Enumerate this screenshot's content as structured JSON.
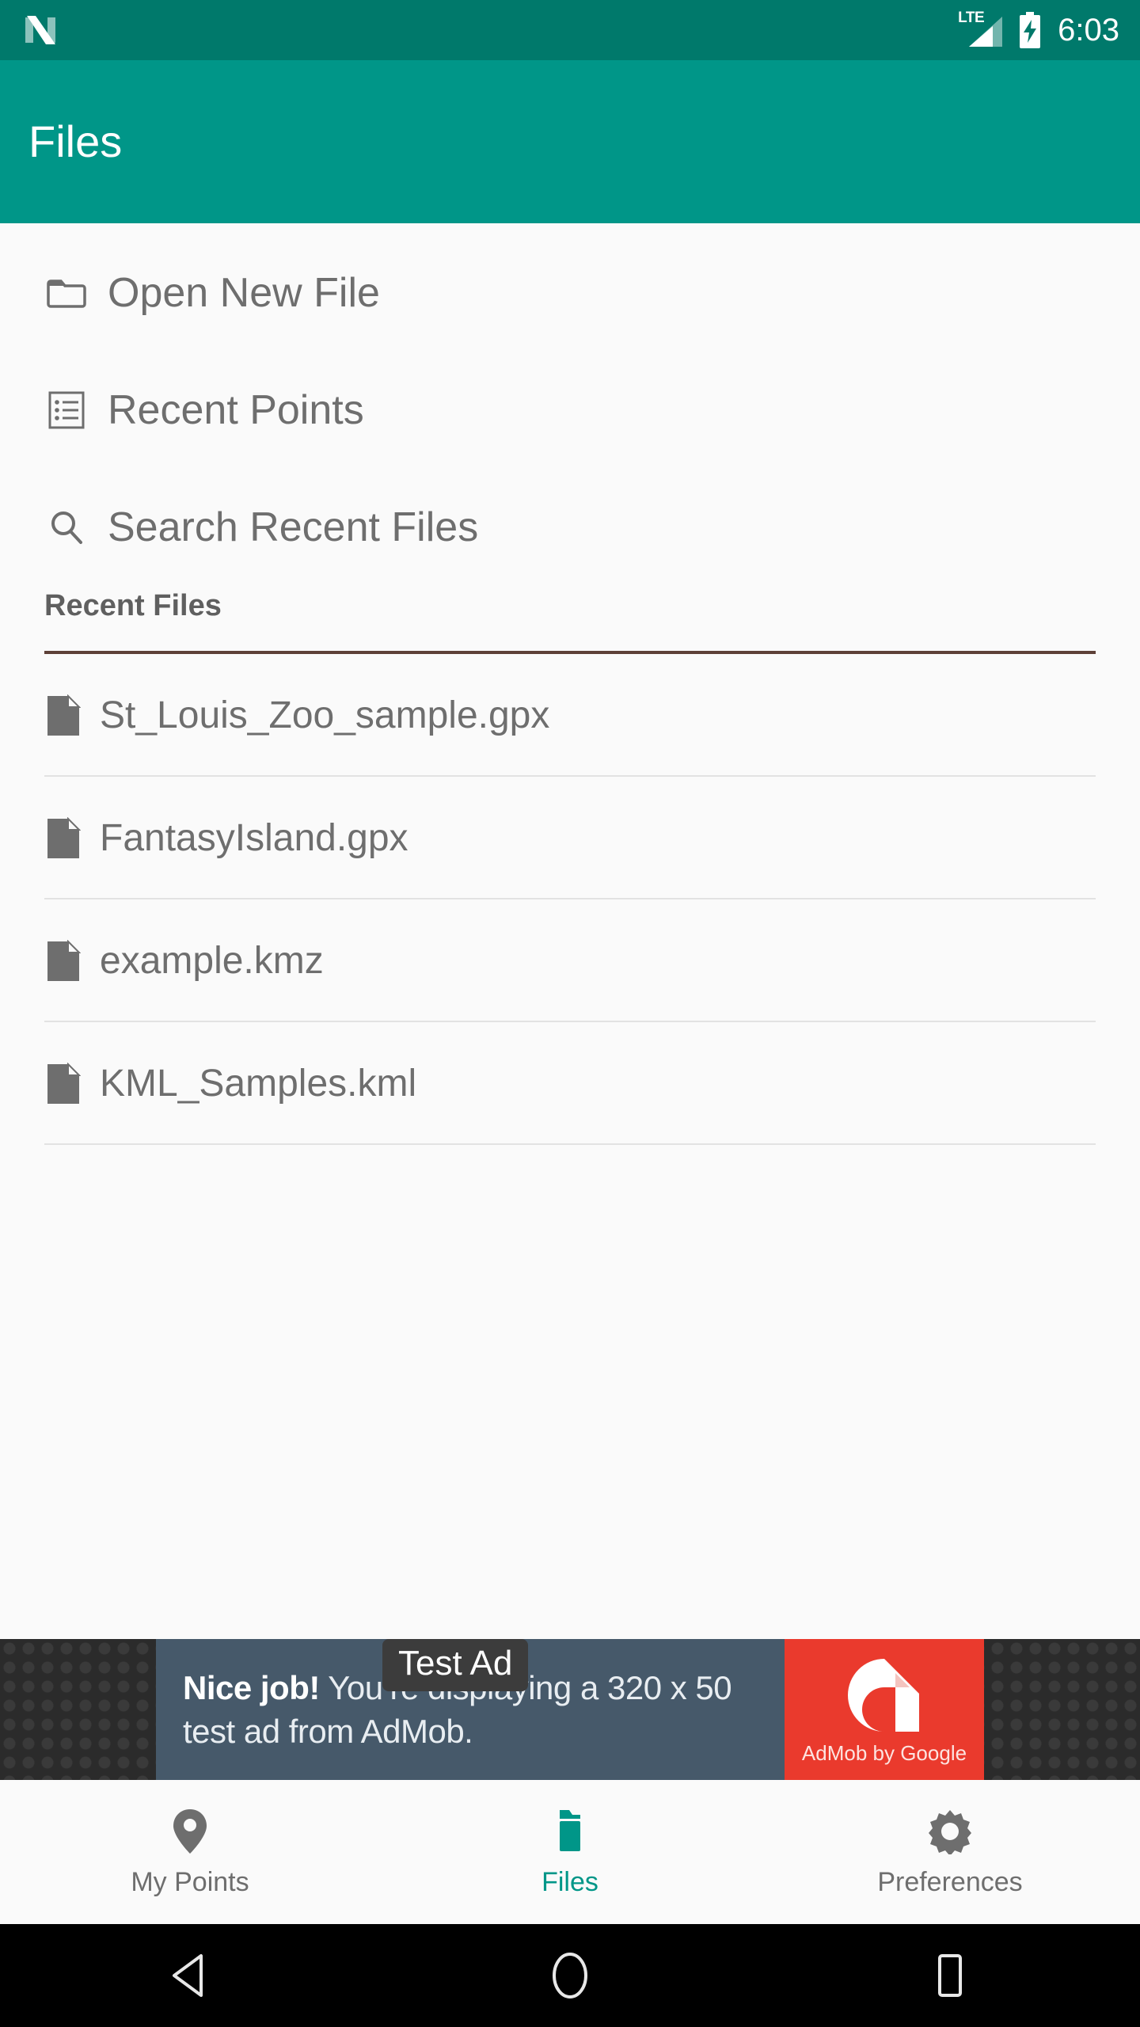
{
  "status_bar": {
    "notification_icon": "android-nougat-icon",
    "network_label": "LTE",
    "signal_icon": "signal-bars-icon",
    "battery_icon": "battery-charging-icon",
    "time": "6:03",
    "background_color": "#00796B"
  },
  "app_bar": {
    "title": "Files",
    "background_color": "#009688",
    "text_color": "#FFFFFF"
  },
  "menu": {
    "items": [
      {
        "label": "Open New File",
        "icon": "folder-icon"
      },
      {
        "label": "Recent Points",
        "icon": "list-document-icon"
      },
      {
        "label": "Search Recent Files",
        "icon": "search-icon"
      }
    ]
  },
  "recent_files": {
    "header": "Recent Files",
    "rule_color": "#5D4037",
    "items": [
      {
        "name": "St_Louis_Zoo_sample.gpx",
        "icon": "file-icon"
      },
      {
        "name": "FantasyIsland.gpx",
        "icon": "file-icon"
      },
      {
        "name": "example.kmz",
        "icon": "file-icon"
      },
      {
        "name": "KML_Samples.kml",
        "icon": "file-icon"
      }
    ]
  },
  "ad": {
    "badge": "Test Ad",
    "line1_bold": "Nice job!",
    "line1_rest": " You’re displaying a 320 x 50",
    "line2": "test ad from AdMob.",
    "logo_caption": "AdMob by Google",
    "logo_icon": "admob-logo-icon",
    "banner_color": "#46596A",
    "logo_panel_color": "#EA3A2D"
  },
  "bottom_nav": {
    "active_color": "#009688",
    "inactive_color": "#6E6E6E",
    "tabs": [
      {
        "label": "My Points",
        "icon": "map-pin-icon",
        "active": false
      },
      {
        "label": "Files",
        "icon": "folder-filled-icon",
        "active": true
      },
      {
        "label": "Preferences",
        "icon": "gear-icon",
        "active": false
      }
    ]
  },
  "system_nav": {
    "back": "back-triangle-icon",
    "home": "home-circle-icon",
    "recents": "recents-square-icon"
  }
}
